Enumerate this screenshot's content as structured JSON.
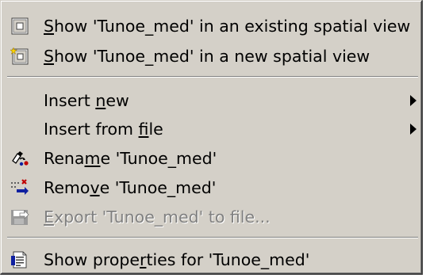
{
  "menu": {
    "items": [
      {
        "pre": "",
        "ul": "S",
        "post": "how 'Tunoe_med' in an existing spatial view",
        "icon": "spatial-view-icon"
      },
      {
        "pre": "",
        "ul": "S",
        "post": "how 'Tunoe_med' in a new spatial view",
        "icon": "new-spatial-view-icon"
      },
      {
        "pre": "Insert ",
        "ul": "n",
        "post": "ew",
        "icon": ""
      },
      {
        "pre": "Insert from ",
        "ul": "f",
        "post": "ile",
        "icon": ""
      },
      {
        "pre": "Rena",
        "ul": "m",
        "post": "e 'Tunoe_med'",
        "icon": "rename-icon"
      },
      {
        "pre": "Remo",
        "ul": "v",
        "post": "e 'Tunoe_med'",
        "icon": "remove-icon"
      },
      {
        "pre": "",
        "ul": "E",
        "post": "xport 'Tunoe_med' to file...",
        "icon": "export-icon"
      },
      {
        "pre": "Show prope",
        "ul": "r",
        "post": "ties for 'Tunoe_med'",
        "icon": "properties-icon"
      }
    ]
  },
  "colors": {
    "menu_background": "#d4d0c8",
    "disabled_text": "#808080"
  }
}
